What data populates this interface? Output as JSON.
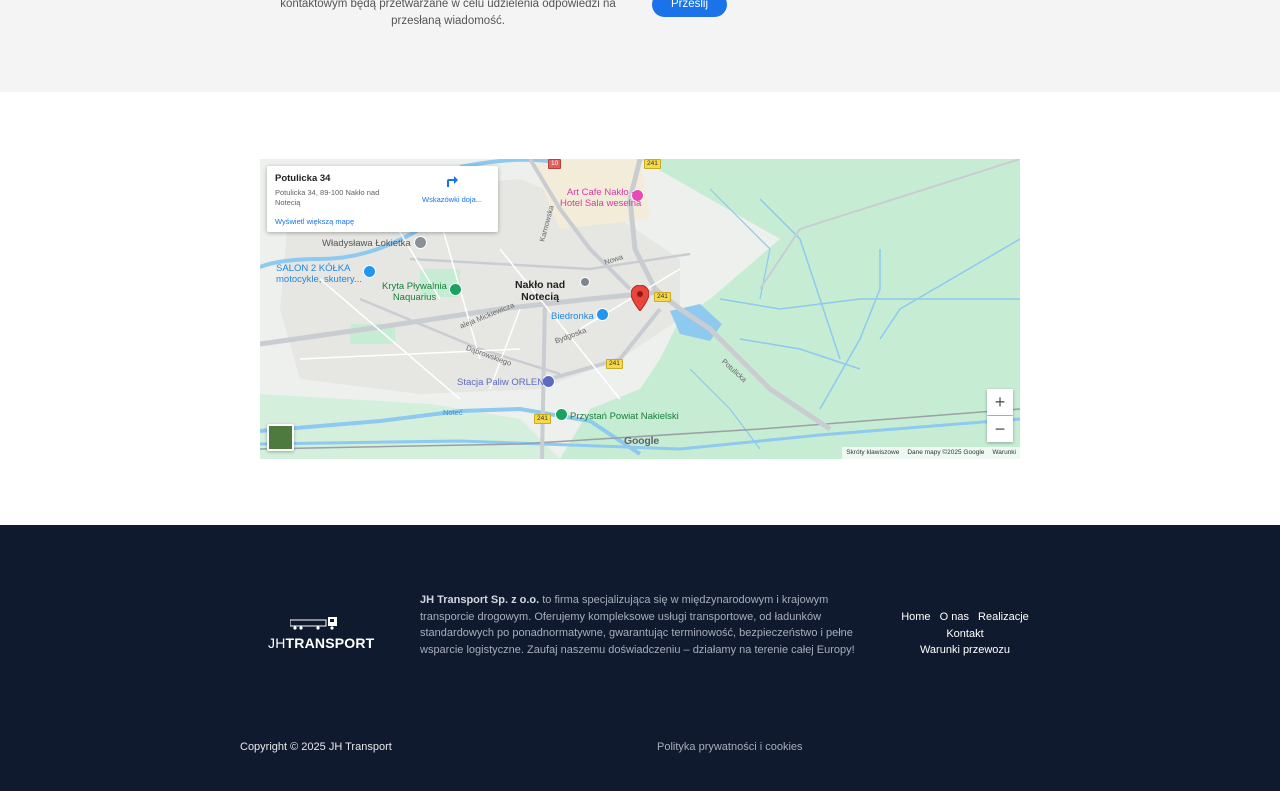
{
  "contact_strip": {
    "consent_text": "kontaktowym będą przetwarzane w celu udzielenia odpowiedzi na przesłaną wiadomość.",
    "submit_label": "Prześlij",
    "accent_color": "#1a73e8"
  },
  "map": {
    "info_card": {
      "title": "Potulicka 34",
      "address": "Potulicka 34, 89-100 Nakło nad Notecią",
      "directions_label": "Wskazówki doja...",
      "larger_map_link": "Wyświetl większą mapę"
    },
    "labels": {
      "art_cafe": "Art Cafe Nakło -\nHotel Sala weselna",
      "lokietka": "Władysława Łokietka",
      "salon": "SALON 2 KÓŁKA\nmotocykle, skutery...",
      "plywalnia": "Kryta Pływalnia\nNaquarius",
      "city": "Nakło nad\nNotecią",
      "biedronka": "Biedronka",
      "orlen": "Stacja Paliw ORLEN",
      "przystan": "Przystań Powiat Nakielski"
    },
    "roads": {
      "karnowska": "Karnowska",
      "nowa": "Nowa",
      "mickiewicza": "aleja Mickiewicza",
      "bydgoska": "Bydgoska",
      "dabrowskiego": "Dąbrowskiego",
      "potulicka": "Potulicka",
      "notec": "Noteć",
      "route_241": "241",
      "route_10": "10"
    },
    "zoom_in": "+",
    "zoom_out": "−",
    "google": "Google",
    "attribution": {
      "shortcuts": "Skróty klawiszowe",
      "data": "Dane mapy ©2025 Google",
      "terms": "Warunki"
    },
    "colors": {
      "water": "#8ec9ef",
      "park": "#c6ecd4",
      "pin": "#e8453c"
    }
  },
  "footer": {
    "logo_thin": "JH",
    "logo_bold": "TRANSPORT",
    "about_company": "JH Transport Sp. z o.o.",
    "about_text": " to firma specjalizująca się w międzynarodowym i krajowym transporcie drogowym. Oferujemy kompleksowe usługi transportowe, od ładunków standardowych po ponadnormatywne, gwarantując terminowość, bezpieczeństwo i pełne wsparcie logistyczne. Zaufaj naszemu doświadczeniu – działamy na terenie całej Europy!",
    "nav": {
      "home": "Home",
      "about": "O nas",
      "projects": "Realizacje",
      "contact": "Kontakt",
      "terms": "Warunki przewozu"
    },
    "copyright": "Copyright © 2025 JH Transport",
    "privacy": "Polityka prywatności i cookies",
    "background_color": "#101a2e"
  }
}
